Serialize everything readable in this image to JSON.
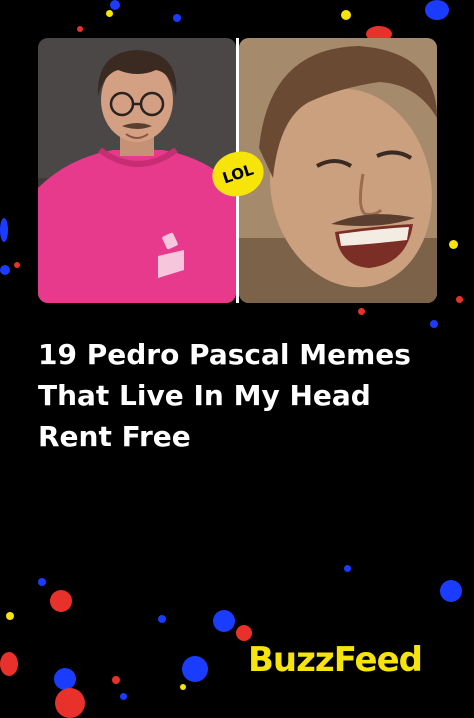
{
  "headline": {
    "line1": "19 Pedro Pascal Memes",
    "line2": "That Live In My Head",
    "line3": "Rent Free"
  },
  "badge": {
    "label": "LOL"
  },
  "brand": {
    "logo_text": "BuzzFeed",
    "logo_color": "#f7e40b"
  },
  "images": {
    "left": {
      "icon": "photo-man-glasses-pink-sweater"
    },
    "right": {
      "icon": "photo-man-laughing"
    }
  },
  "colors": {
    "background": "#000000",
    "accent_yellow": "#f7e40b",
    "sweater_pink": "#e83a8c",
    "dot_red": "#e8312a",
    "dot_blue": "#1a3cff"
  }
}
